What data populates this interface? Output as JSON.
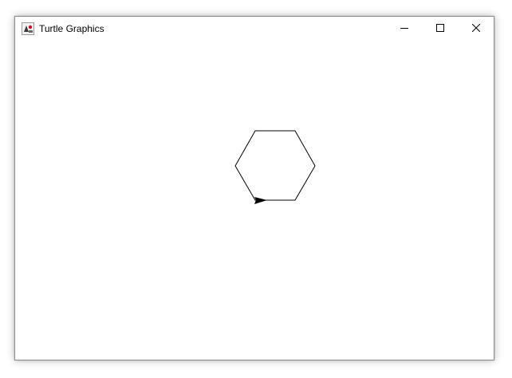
{
  "window": {
    "title": "Turtle Graphics",
    "app_icon": "java-duke-icon",
    "controls": {
      "minimize_icon": "minimize-icon",
      "maximize_icon": "maximize-icon",
      "close_icon": "close-icon"
    }
  },
  "canvas": {
    "background": "#ffffff",
    "drawing": {
      "shape": "hexagon",
      "sides": 6,
      "stroke_color": "#000000",
      "turtle_color": "#000000",
      "turtle_heading": "east"
    }
  }
}
